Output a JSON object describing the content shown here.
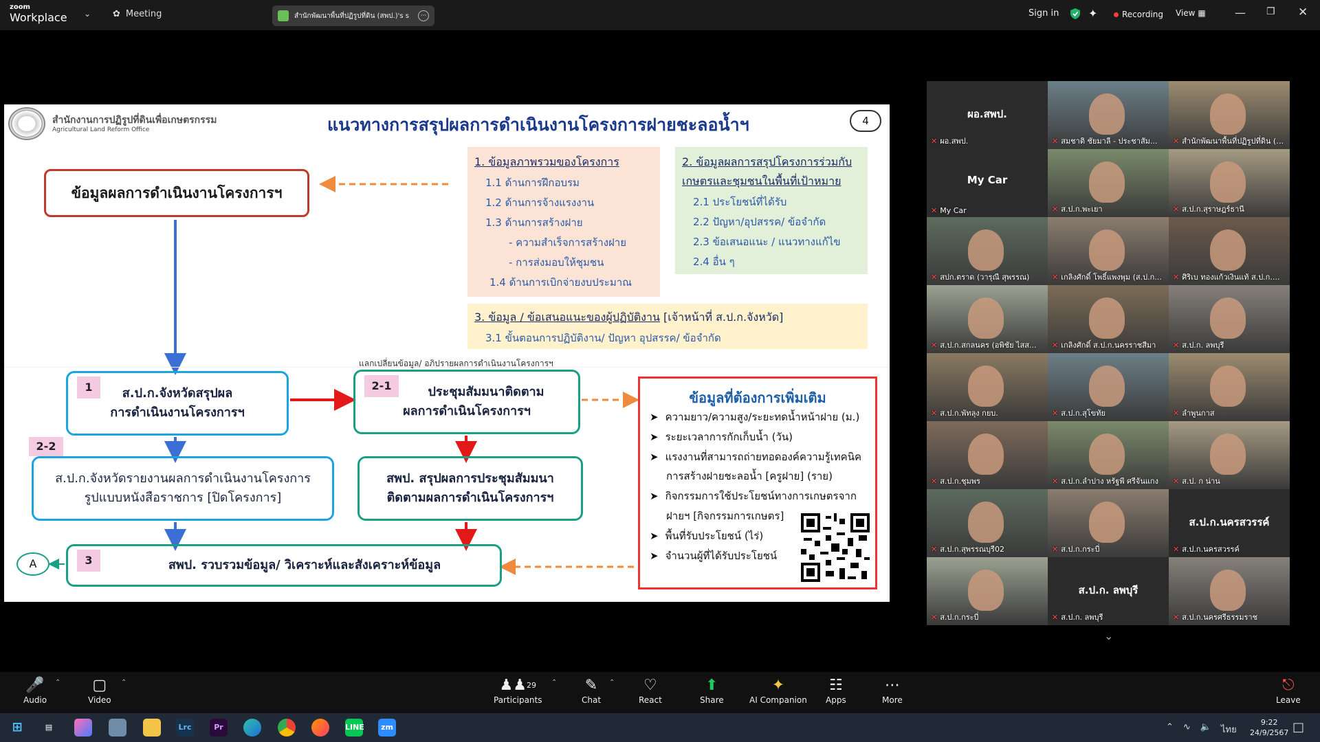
{
  "titlebar": {
    "logo_small": "zoom",
    "logo_big": "Workplace",
    "meeting_label": "Meeting",
    "share_tab_title": "สำนักพัฒนาพื้นที่ปฏิรูปที่ดิน (สพป.)'s s",
    "sign_in": "Sign in",
    "recording": "Recording",
    "view": "View"
  },
  "slide": {
    "org_th": "สำนักงานการปฏิรูปที่ดินเพื่อเกษตรกรรม",
    "org_en": "Agricultural Land Reform Office",
    "title": "แนวทางการสรุปผลการดำเนินงานโครงการฝายชะลอน้ำฯ",
    "page_number": "4",
    "main_box": "ข้อมูลผลการดำเนินงานโครงการฯ",
    "overview": {
      "heading": "1. ข้อมูลภาพรวมของโครงการ",
      "items": [
        "1.1 ด้านการฝึกอบรม",
        "1.2 ด้านการจ้างแรงงาน",
        "1.3 ด้านการสร้างฝาย",
        "- ความสำเร็จการสร้างฝาย",
        "- การส่งมอบให้ชุมชน",
        "1.4 ด้านการเบิกจ่ายงบประมาณ"
      ]
    },
    "results": {
      "heading_1": "2. ข้อมูลผลการสรุปโครงการร่วมกับ",
      "heading_2": "เกษตรและชุมชนในพื้นที่เป้าหมาย",
      "items": [
        "2.1 ประโยชน์ที่ได้รับ",
        "2.2 ปัญหา/อุปสรรค/ ข้อจำกัด",
        "2.3 ข้อเสนอแนะ / แนวทางแก้ไข",
        "2.4 อื่น ๆ"
      ]
    },
    "staff": {
      "heading_a": "3. ข้อมูล / ข้อเสนอแนะของผู้ปฏิบัติงาน",
      "heading_b": " [เจ้าหน้าที่ ส.ป.ก.จังหวัด]",
      "item": "3.1 ขั้นตอนการปฏิบัติงาน/ ปัญหา อุปสรรค/ ข้อจำกัด"
    },
    "exchange_note": "แลกเปลี่ยนข้อมูล/ อภิปรายผลการดำเนินงานโครงการฯ",
    "box1": {
      "badge": "1",
      "line1": "ส.ป.ก.จังหวัดสรุปผล",
      "line2": "การดำเนินงานโครงการฯ"
    },
    "box21": {
      "badge": "2-1",
      "line1": "ประชุมสัมมนาติดตาม",
      "line2": "ผลการดำเนินโครงการฯ"
    },
    "box22": {
      "badge": "2-2",
      "line1": "ส.ป.ก.จังหวัดรายงานผลการดำเนินงานโครงการ",
      "line2": "รูปแบบหนังสือราชการ [ปิดโครงการ]"
    },
    "box_sp": {
      "line1": "สพป. สรุปผลการประชุมสัมมนา",
      "line2": "ติดตามผลการดำเนินโครงการฯ"
    },
    "box3": {
      "badge": "3",
      "text": "สพป. รวบรวมข้อมูล/ วิเคราะห์และสังเคราะห์ข้อมูล"
    },
    "box_a": "A",
    "more": {
      "title": "ข้อมูลที่ต้องการเพิ่มเติม",
      "items": [
        "ความยาว/ความสูง/ระยะทดน้ำหน้าฝาย (ม.)",
        "ระยะเวลาการกักเก็บน้ำ (วัน)",
        "แรงงานที่สามารถถ่ายทอดองค์ความรู้เทคนิค",
        "การสร้างฝายชะลอน้ำ [ครูฝาย] (ราย)",
        "กิจกรรมการใช้ประโยชน์ทางการเกษตรจาก",
        "ฝายฯ [กิจกรรมการเกษตร]",
        "พื้นที่รับประโยชน์ (ไร่)",
        "จำนวนผู้ที่ได้รับประโยชน์"
      ]
    }
  },
  "gallery": {
    "tiles": [
      {
        "big": "ผอ.สพป.",
        "name": "ผอ.สพป."
      },
      {
        "big": "",
        "name": "สมชาติ ชัยมาลี - ประชาสัม..."
      },
      {
        "big": "",
        "name": "สำนักพัฒนาพื้นที่ปฏิรูปที่ดิน (ส..."
      },
      {
        "big": "My  Car",
        "name": "My  Car"
      },
      {
        "big": "",
        "name": "ส.ป.ก.พะเยา"
      },
      {
        "big": "",
        "name": "ส.ป.ก.สุราษฎร์ธานี"
      },
      {
        "big": "",
        "name": "สปก.ตราด (วารุณี สุพรรณ)"
      },
      {
        "big": "",
        "name": "เกลิงศักดิ์ โพธิ์แพงพุม (ส.ป.ก..."
      },
      {
        "big": "",
        "name": "ศิริเบ ทองแก้วเงินแท้ ส.ป.ก...."
      },
      {
        "big": "",
        "name": "ส.ป.ก.สกลนคร (อพิชัย ไสส..."
      },
      {
        "big": "",
        "name": "เกลิงศักดิ์ ส.ป.ก.นครราชสีมา"
      },
      {
        "big": "",
        "name": "ส.ป.ก. ลพบุรี"
      },
      {
        "big": "",
        "name": "ส.ป.ก.พัทลุง กยบ."
      },
      {
        "big": "",
        "name": "ส.ป.ก.สุโขทัย"
      },
      {
        "big": "",
        "name": "ลำพูนกาส"
      },
      {
        "big": "",
        "name": "ส.ป.ก.ชุมพร"
      },
      {
        "big": "",
        "name": "ส.ป.ก.ลำปาง หรัฐพี ศรีจันแกง"
      },
      {
        "big": "",
        "name": "ส.ป. ก น่าน"
      },
      {
        "big": "",
        "name": "ส.ป.ก.สุพรรณบุรี02"
      },
      {
        "big": "",
        "name": "ส.ป.ก.กระบี่"
      },
      {
        "big": "ส.ป.ก.นครสวรรค์",
        "name": "ส.ป.ก.นครสวรรค์"
      },
      {
        "big": "",
        "name": "ส.ป.ก.กระบี่"
      },
      {
        "big": "ส.ป.ก. ลพบุรี",
        "name": "ส.ป.ก. ลพบุรี"
      },
      {
        "big": "",
        "name": "ส.ป.ก.นครศรีธรรมราช"
      }
    ]
  },
  "toolbar": {
    "audio": "Audio",
    "video": "Video",
    "participants": "Participants",
    "participants_count": "29",
    "chat": "Chat",
    "react": "React",
    "share": "Share",
    "ai": "AI Companion",
    "apps": "Apps",
    "more": "More",
    "leave": "Leave"
  },
  "taskbar": {
    "lang": "ไทย",
    "time": "9:22",
    "date": "24/9/2567"
  }
}
